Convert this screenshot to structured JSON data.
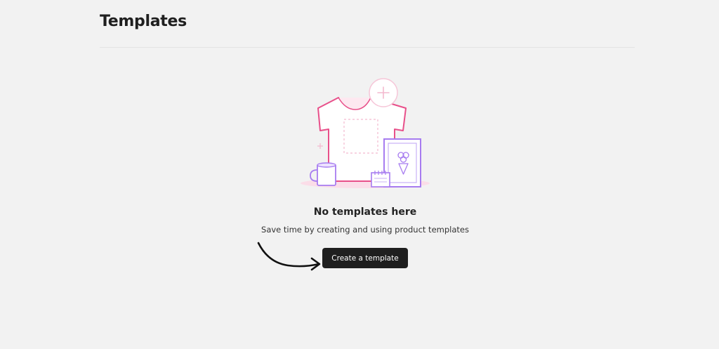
{
  "header": {
    "title": "Templates"
  },
  "empty_state": {
    "illustration_icon": "tshirt-products-illustration",
    "title": "No templates here",
    "subtitle": "Save time by creating and using product templates",
    "button_label": "Create a template"
  },
  "annotation": {
    "icon": "curved-arrow-icon"
  },
  "colors": {
    "background": "#f2f2f2",
    "button_bg": "#1f1f1f",
    "button_text": "#ffffff",
    "accent_pink": "#e8508a",
    "accent_purple": "#a77cf0"
  }
}
